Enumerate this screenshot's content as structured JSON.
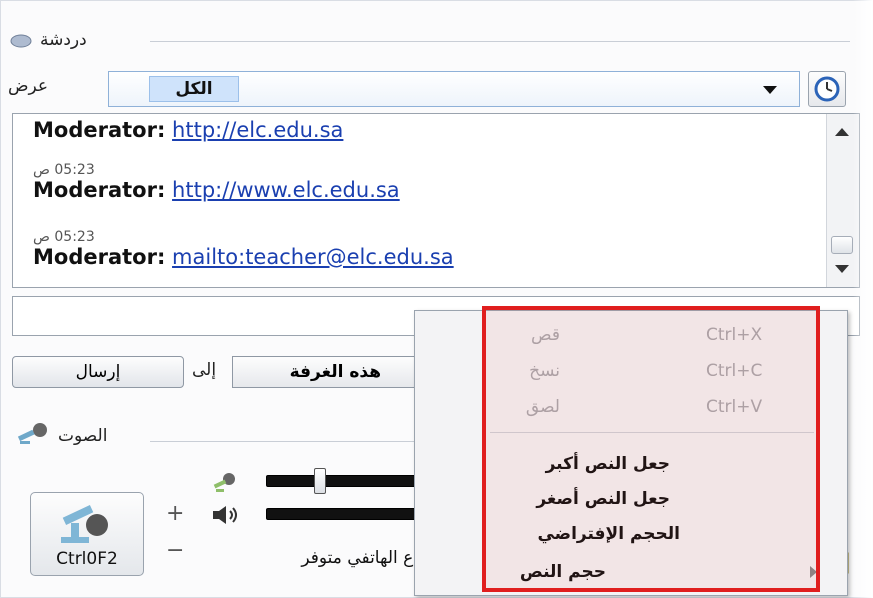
{
  "chat": {
    "section_title": "دردشة",
    "show_label": "عرض",
    "filter_value": "الكل",
    "messages": [
      {
        "time": "",
        "sender": "Moderator:",
        "link": "http://elc.edu.sa"
      },
      {
        "time": "05:23 ص",
        "sender": "Moderator:",
        "link": "http://www.elc.edu.sa"
      },
      {
        "time": "05:23 ص",
        "sender": "Moderator:",
        "link": "mailto:teacher@elc.edu.sa"
      }
    ],
    "input_value": "",
    "send_label": "إرسال",
    "to_label": "إلى",
    "room_value": "هذه الغرفة"
  },
  "audio": {
    "section_title": "الصوت",
    "mic_button_label": "Ctrl0F2",
    "plus": "+",
    "minus": "−",
    "phone_status": "اع الهاتفي متوفر"
  },
  "context_menu": {
    "items": [
      {
        "label": "قص",
        "shortcut": "Ctrl+X"
      },
      {
        "label": "نسخ",
        "shortcut": "Ctrl+C"
      },
      {
        "label": "لصق",
        "shortcut": "Ctrl+V"
      },
      {
        "label": "جعل النص أكبر"
      },
      {
        "label": "جعل النص أصغر"
      },
      {
        "label": "الحجم الإفتراضي"
      },
      {
        "label": "حجم النص"
      }
    ]
  },
  "colors": {
    "highlight": "#e01e1e",
    "link": "#1a3fb0",
    "selected_fill": "#cfe3fb"
  },
  "icons": [
    "chat-bubble-icon",
    "clock-icon",
    "chevron-down-icon",
    "microphone-icon",
    "speaker-icon",
    "warning-icon",
    "submenu-arrow-icon"
  ]
}
